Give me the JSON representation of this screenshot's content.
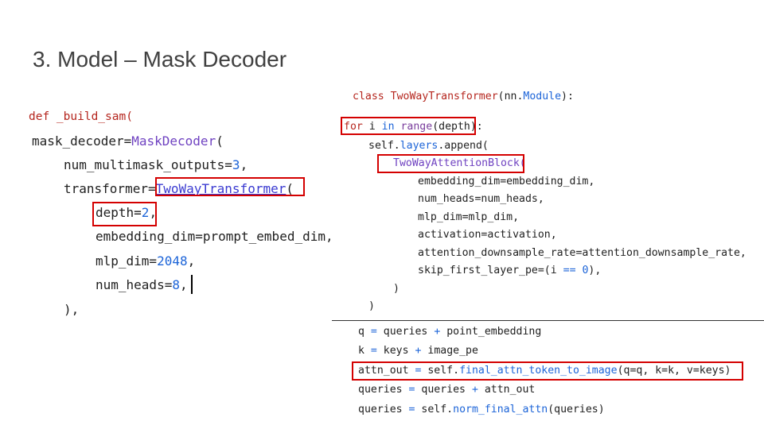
{
  "slide": {
    "title": "3. Model – Mask Decoder"
  },
  "left_code": {
    "l1_def": "def",
    "l1_name": " _build_sam(",
    "l2_a": "mask_decoder=",
    "l2_b": "MaskDecoder",
    "l2_c": "(",
    "l3_a": "num_multimask_outputs=",
    "l3_b": "3",
    "l3_c": ",",
    "l4_a": "transformer=",
    "l4_b": "TwoWayTransformer",
    "l4_c": "(",
    "l5_a": "depth=",
    "l5_b": "2",
    "l5_c": ",",
    "l6": "embedding_dim=prompt_embed_dim,",
    "l7_a": "mlp_dim=",
    "l7_b": "2048",
    "l7_c": ",",
    "l8_a": "num_heads=",
    "l8_b": "8",
    "l8_c": ",",
    "l9": "),"
  },
  "right_code": {
    "c1_kw": "class",
    "c1_name": "TwoWayTransformer",
    "c1_rest": "(nn.",
    "c1_mod": "Module",
    "c1_end": "):",
    "f_for": "for",
    "f_i": " i ",
    "f_in": "in",
    "f_range": " range",
    "f_rest": "(depth):",
    "a1_a": "self.",
    "a1_b": "layers",
    "a1_c": ".append(",
    "a2": "TwoWayAttentionBlock(",
    "p1": "embedding_dim=embedding_dim,",
    "p2": "num_heads=num_heads,",
    "p3": "mlp_dim=mlp_dim,",
    "p4": "activation=activation,",
    "p5": "attention_downsample_rate=attention_downsample_rate,",
    "p6_a": "skip_first_layer_pe=(i ",
    "p6_b": "==",
    "p6_c": " ",
    "p6_d": "0",
    "p6_e": "),",
    "close1": ")",
    "close2": ")"
  },
  "bottom_code": {
    "b1_a": "q ",
    "b1_b": "=",
    "b1_c": " queries ",
    "b1_d": "+",
    "b1_e": " point_embedding",
    "b2_a": "k ",
    "b2_b": "=",
    "b2_c": " keys ",
    "b2_d": "+",
    "b2_e": " image_pe",
    "b3_a": "attn_out ",
    "b3_b": "=",
    "b3_c": " self.",
    "b3_d": "final_attn_token_to_image",
    "b3_e": "(q=q, k=k, v=keys)",
    "b4_a": "queries ",
    "b4_b": "=",
    "b4_c": " queries ",
    "b4_d": "+",
    "b4_e": " attn_out",
    "b5_a": "queries ",
    "b5_b": "=",
    "b5_c": " self.",
    "b5_d": "norm_final_attn",
    "b5_e": "(queries)"
  },
  "colors": {
    "highlight_box": "#d40000",
    "keyword_red": "#b5261e",
    "number_blue": "#1c64d8",
    "class_purple": "#6f42c1"
  }
}
